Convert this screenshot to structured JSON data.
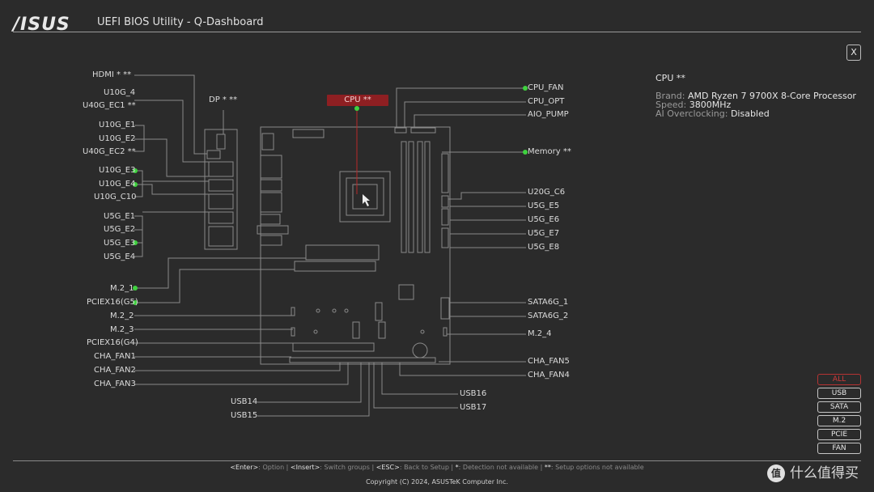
{
  "header": {
    "logo": "/ISUS",
    "title": "UEFI BIOS Utility - Q-Dashboard",
    "close_label": "X"
  },
  "cpu_tag": "CPU **",
  "left_labels": {
    "hdmi": "HDMI * **",
    "u10g_4": "U10G_4",
    "u40g_ec1": "U40G_EC1 **",
    "u10g_e1": "U10G_E1",
    "u10g_e2": "U10G_E2",
    "u40g_ec2": "U40G_EC2 **",
    "u10g_e3": "U10G_E3",
    "u10g_e4": "U10G_E4",
    "u10g_c10": "U10G_C10",
    "u5g_e1": "U5G_E1",
    "u5g_e2": "U5G_E2",
    "u5g_e3": "U5G_E3",
    "u5g_e4": "U5G_E4",
    "m2_1": "M.2_1",
    "pciex16_g5": "PCIEX16(G5)",
    "m2_2": "M.2_2",
    "m2_3": "M.2_3",
    "pciex16_g4": "PCIEX16(G4)",
    "cha_fan1": "CHA_FAN1",
    "cha_fan2": "CHA_FAN2",
    "cha_fan3": "CHA_FAN3",
    "dp": "DP * **",
    "usb14": "USB14",
    "usb15": "USB15"
  },
  "right_labels": {
    "cpu_fan": "CPU_FAN",
    "cpu_opt": "CPU_OPT",
    "aio_pump": "AIO_PUMP",
    "memory": "Memory **",
    "u20g_c6": "U20G_C6",
    "u5g_e5": "U5G_E5",
    "u5g_e6": "U5G_E6",
    "u5g_e7": "U5G_E7",
    "u5g_e8": "U5G_E8",
    "sata6g_1": "SATA6G_1",
    "sata6g_2": "SATA6G_2",
    "m2_4": "M.2_4",
    "cha_fan5": "CHA_FAN5",
    "cha_fan4": "CHA_FAN4",
    "usb16": "USB16",
    "usb17": "USB17"
  },
  "info_panel": {
    "title": "CPU **",
    "brand_key": "Brand:",
    "brand_val": "AMD Ryzen 7 9700X 8-Core Processor",
    "speed_key": "Speed:",
    "speed_val": "3800MHz",
    "ai_key": "AI Overclocking:",
    "ai_val": "Disabled"
  },
  "filters": [
    "ALL",
    "USB",
    "SATA",
    "M.2",
    "PCIE",
    "FAN"
  ],
  "footer": {
    "k1": "<Enter>",
    "t1": ": Option | ",
    "k2": "<Insert>",
    "t2": ": Switch groups | ",
    "k3": "<ESC>",
    "t3": ": Back to Setup | ",
    "k4": "*",
    "t4": ": Detection not available | ",
    "k5": "**",
    "t5": ": Setup options not available",
    "copyright": "Copyright (C) 2024, ASUSTeK Computer Inc.",
    "watermark": "什么值得买",
    "watermark_icon": "值"
  },
  "colors": {
    "accent_green": "#3fd23f",
    "cpu_red": "#8e1f22",
    "line": "#8a8a8a"
  }
}
